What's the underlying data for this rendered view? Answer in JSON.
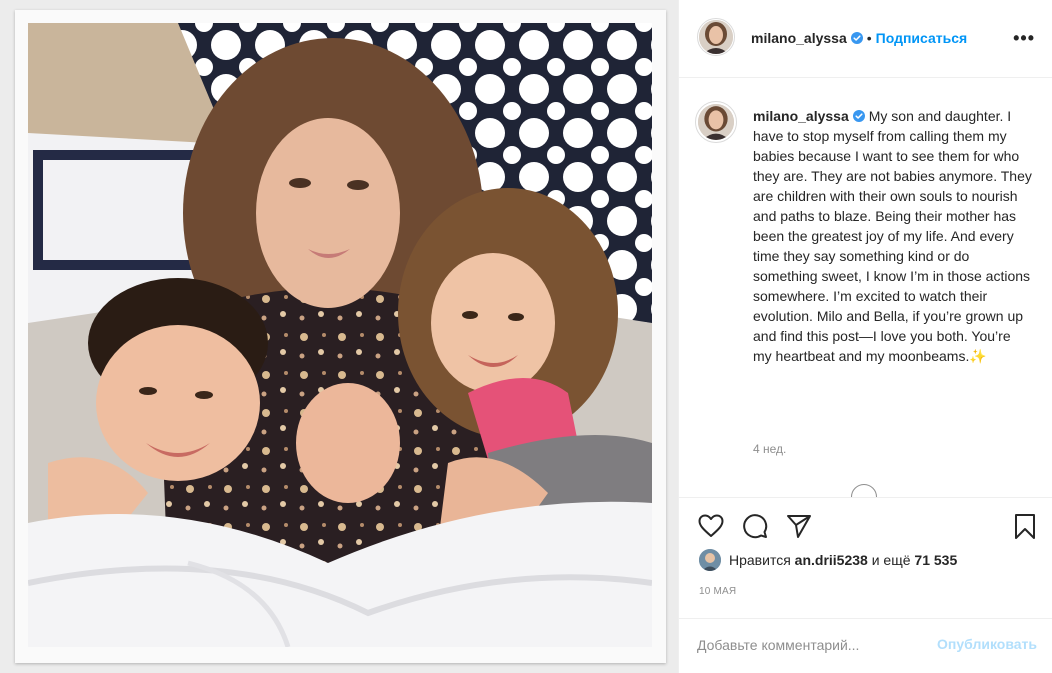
{
  "post": {
    "username": "milano_alyssa",
    "separator": "•",
    "follow_label": "Подписаться",
    "more_label": "•••",
    "caption_text": "My son and daughter. I have to stop myself from calling them my babies because I want to see them for who they are. They are not babies anymore. They are children with their own souls to nourish and paths to blaze. Being their mother has been the greatest joy of my life. And every time they say something kind or do something sweet, I know I’m in those actions somewhere. I’m excited to watch their evolution. Milo and Bella, if you’re grown up and find this post—I love you both. You’re my heartbeat and my moonbeams.",
    "caption_emoji": "✨",
    "caption_time": "4 нед.",
    "liked_prefix": "Нравится",
    "liked_user": "an.drii5238",
    "liked_suffix": "и ещё",
    "liked_count": "71 535",
    "date": "10 МАЯ",
    "comment_placeholder": "Добавьте комментарий...",
    "publish_label": "Опубликовать"
  },
  "icons": {
    "verified": "verified-badge-icon",
    "like": "heart-icon",
    "comment": "comment-bubble-icon",
    "share": "paper-plane-icon",
    "save": "bookmark-icon",
    "more": "more-options-icon",
    "load_more": "plus-circle-icon"
  },
  "colors": {
    "accent": "#0095f6",
    "publish_disabled": "#b2dffc",
    "muted": "#8e8e8e",
    "text": "#262626",
    "border": "#efefef"
  }
}
